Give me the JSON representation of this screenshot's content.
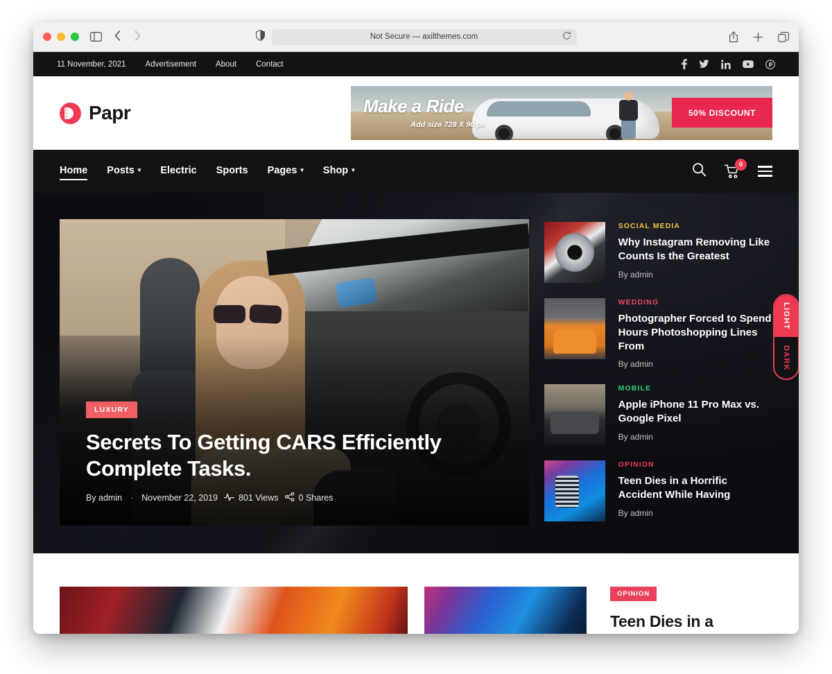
{
  "browser": {
    "url_text": "Not Secure — axilthemes.com",
    "icons": {
      "sidebar": "sidebar-icon",
      "back": "back-arrow-icon",
      "forward": "forward-arrow-icon",
      "shield": "shield-icon",
      "reload": "reload-icon",
      "share": "share-icon",
      "new_tab": "plus-icon",
      "tabs": "tab-overview-icon"
    }
  },
  "topbar": {
    "date": "11 November, 2021",
    "links": [
      {
        "label": "Advertisement"
      },
      {
        "label": "About"
      },
      {
        "label": "Contact"
      }
    ],
    "social": [
      {
        "name": "facebook-icon",
        "glyph": "f"
      },
      {
        "name": "twitter-icon",
        "glyph": "t"
      },
      {
        "name": "linkedin-icon",
        "glyph": "in"
      },
      {
        "name": "youtube-icon",
        "glyph": "yt"
      },
      {
        "name": "pinterest-icon",
        "glyph": "p"
      }
    ]
  },
  "header": {
    "logo_text": "Papr",
    "ad": {
      "title": "Make a Ride",
      "subtitle": "Add size 728 X 90 px",
      "button": "50% DISCOUNT",
      "button_color": "#e8284f"
    }
  },
  "nav": {
    "items": [
      {
        "label": "Home",
        "has_caret": false,
        "active": true
      },
      {
        "label": "Posts",
        "has_caret": true,
        "active": false
      },
      {
        "label": "Electric",
        "has_caret": false,
        "active": false
      },
      {
        "label": "Sports",
        "has_caret": false,
        "active": false
      },
      {
        "label": "Pages",
        "has_caret": true,
        "active": false
      },
      {
        "label": "Shop",
        "has_caret": true,
        "active": false
      }
    ],
    "cart_count": "0"
  },
  "hero": {
    "category": "LUXURY",
    "category_color": "#ef5f63",
    "title": "Secrets To Getting CARS Efficiently Complete Tasks.",
    "author": "By admin",
    "separator": "·",
    "date": "November 22, 2019",
    "views": "801 Views",
    "shares": "0 Shares"
  },
  "hero_list": [
    {
      "category": "SOCIAL MEDIA",
      "category_color": "#f0c23c",
      "title": "Why Instagram Removing Like Counts Is the Greatest",
      "author": "By admin"
    },
    {
      "category": "WEDDING",
      "category_color": "#ec4a6b",
      "title": "Photographer Forced to Spend Hours Photoshopping Lines From",
      "author": "By admin"
    },
    {
      "category": "MOBILE",
      "category_color": "#2fd07a",
      "title": "Apple iPhone 11 Pro Max vs. Google Pixel",
      "author": "By admin"
    },
    {
      "category": "OPINION",
      "category_color": "#ee3a52",
      "title": "Teen Dies in a Horrific Accident While Having",
      "author": "By admin"
    }
  ],
  "mode_switch": {
    "light_label": "LIGHT",
    "dark_label": "DARK",
    "accent": "#ee3a52",
    "active": "LIGHT"
  },
  "bottom": {
    "badge": "OPINION",
    "badge_color": "#e8425c",
    "title": "Teen Dies in a Horrific"
  }
}
